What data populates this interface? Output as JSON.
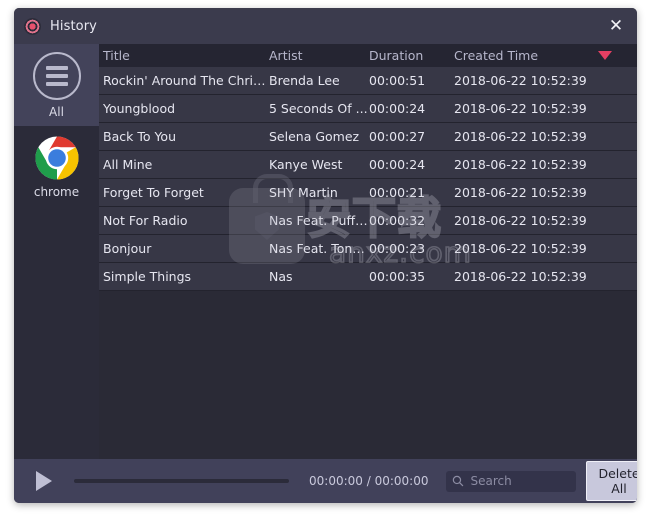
{
  "window": {
    "title": "History",
    "app_icon": "record-circle-icon",
    "close_icon": "close-icon"
  },
  "sidebar": {
    "items": [
      {
        "label": "All",
        "icon": "hamburger-circle-icon",
        "selected": true
      },
      {
        "label": "chrome",
        "icon": "chrome-logo-icon",
        "selected": false
      }
    ]
  },
  "table": {
    "columns": [
      "Title",
      "Artist",
      "Duration",
      "Created Time"
    ],
    "sort_indicator": "sort-descending-caret-icon",
    "sort_color": "#e63f63",
    "rows": [
      {
        "title": "Rockin' Around The Christ...",
        "artist": "Brenda Lee",
        "duration": "00:00:51",
        "created": "2018-06-22 10:52:39"
      },
      {
        "title": "Youngblood",
        "artist": "5 Seconds Of ...",
        "duration": "00:00:24",
        "created": "2018-06-22 10:52:39"
      },
      {
        "title": "Back To You",
        "artist": "Selena Gomez",
        "duration": "00:00:27",
        "created": "2018-06-22 10:52:39"
      },
      {
        "title": "All Mine",
        "artist": "Kanye West",
        "duration": "00:00:24",
        "created": "2018-06-22 10:52:39"
      },
      {
        "title": "Forget To Forget",
        "artist": "SHY Martin",
        "duration": "00:00:21",
        "created": "2018-06-22 10:52:39"
      },
      {
        "title": "Not For Radio",
        "artist": "Nas Feat. Puff ...",
        "duration": "00:00:32",
        "created": "2018-06-22 10:52:39"
      },
      {
        "title": "Bonjour",
        "artist": "Nas Feat. Tony...",
        "duration": "00:00:23",
        "created": "2018-06-22 10:52:39"
      },
      {
        "title": "Simple Things",
        "artist": "Nas",
        "duration": "00:00:35",
        "created": "2018-06-22 10:52:39"
      }
    ]
  },
  "watermark": {
    "text_cn": "安下载",
    "url": "anxz.com",
    "logo": "bag-shield-icon"
  },
  "bottombar": {
    "play_icon": "play-icon",
    "time": "00:00:00 / 00:00:00",
    "search_icon": "search-icon",
    "search_value": "",
    "search_placeholder": "Search",
    "delete_all_label": "Delete All"
  }
}
